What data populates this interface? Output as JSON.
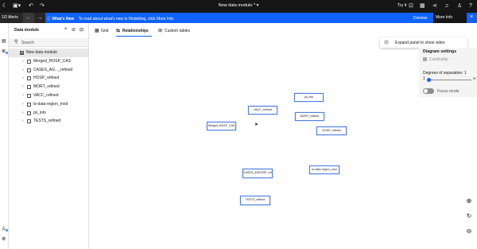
{
  "topbar": {
    "module_title": "New data module *",
    "try_it": "Try it",
    "icons": [
      "menu-icon",
      "save-icon",
      "undo-icon",
      "redo-icon",
      "try-it-toggle",
      "chart-icon",
      "share-icon",
      "notifications-icon",
      "user-icon",
      "help-icon"
    ]
  },
  "alert": {
    "count": "1/2 Alerts",
    "prev": "←",
    "next": "→",
    "heading": "What's New",
    "message": "To read about what's new in Modelling, click More Info.",
    "dismiss": "Dismiss",
    "more_info": "More Info",
    "close": "×"
  },
  "panel": {
    "title": "Data module",
    "search_placeholder": "Search",
    "root": "New data module",
    "items": [
      {
        "label": "Merged_HOSP_CAS"
      },
      {
        "label": "CASES_AG..._refined"
      },
      {
        "label": "HOSP_refined"
      },
      {
        "label": "MORT_refined"
      },
      {
        "label": "VACC_refined"
      },
      {
        "label": "ts-data-region_mod"
      },
      {
        "label": "pii_info"
      },
      {
        "label": "TESTS_refined"
      }
    ]
  },
  "tabs": [
    {
      "label": "Grid"
    },
    {
      "label": "Relationships"
    },
    {
      "label": "Custom tables"
    }
  ],
  "canvas": {
    "nodes": [
      {
        "label": "pii_info"
      },
      {
        "label": "VACC_refined"
      },
      {
        "label": "MORT_refined"
      },
      {
        "label": "Merged_HOSP_CAS"
      },
      {
        "label": "HOSP_refined"
      },
      {
        "label": "ts-data-region_mod"
      },
      {
        "label": "CASES_AGEGRP_refined"
      },
      {
        "label": "TESTS_refined"
      }
    ]
  },
  "popup": {
    "label": "Expand panel to show video"
  },
  "settings": {
    "title": "Diagram settings",
    "cardinality": "Cardinality",
    "degrees_label": "Degrees of separation: 1",
    "degrees_min": "1",
    "degrees_max": "∞",
    "degrees_value": 1,
    "focus_mode": "Focus mode",
    "focus_mode_on": false
  },
  "colors": {
    "accent": "#0f62fe",
    "node_border": "#4d7fde",
    "topbar": "#161616"
  }
}
